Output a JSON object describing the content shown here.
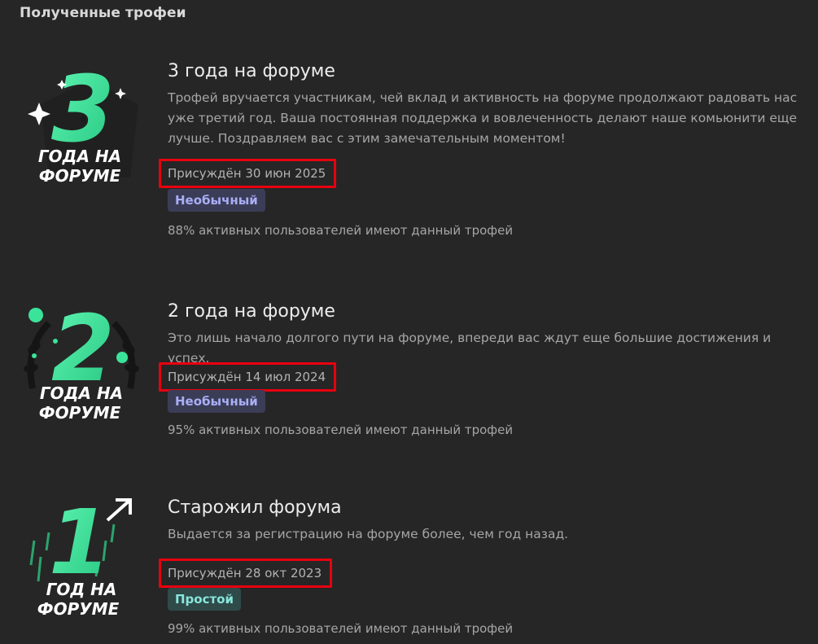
{
  "page": {
    "section_title": "Полученные трофеи"
  },
  "colors": {
    "background": "#262626",
    "accent_green": "#3be39a",
    "highlight_red": "#e8000f",
    "uncommon_badge": "#3b3d57",
    "common_badge": "#2f4a49"
  },
  "trophies": [
    {
      "badge": {
        "number": "3",
        "line1": "ГОДА НА",
        "line2": "ФОРУМЕ",
        "icon": "three-years-badge-icon"
      },
      "title": "3 года на форуме",
      "description": "Трофей вручается участникам, чей вклад и активность на форуме продолжают радовать нас уже третий год. Ваша постоянная поддержка и вовлеченность делают наше комьюнити еще лучше. Поздравляем вас с этим замечательным моментом!",
      "awarded": "Присуждён 30 июн 2025",
      "rarity": "Необычный",
      "stat": "88% активных пользователей имеют данный трофей"
    },
    {
      "badge": {
        "number": "2",
        "line1": "ГОДА НА",
        "line2": "ФОРУМЕ",
        "icon": "two-years-badge-icon"
      },
      "title": "2 года на форуме",
      "description": "Это лишь начало долгого пути на форуме, впереди вас ждут еще большие достижения и успех.",
      "awarded": "Присуждён 14 июл 2024",
      "rarity": "Необычный",
      "stat": "95% активных пользователей имеют данный трофей"
    },
    {
      "badge": {
        "number": "1",
        "line1": "ГОД НА",
        "line2": "ФОРУМЕ",
        "icon": "one-year-badge-icon"
      },
      "title": "Старожил форума",
      "description": "Выдается за регистрацию на форуме более, чем год назад.",
      "awarded": "Присуждён 28 окт 2023",
      "rarity": "Простой",
      "stat": "99% активных пользователей имеют данный трофей"
    }
  ]
}
